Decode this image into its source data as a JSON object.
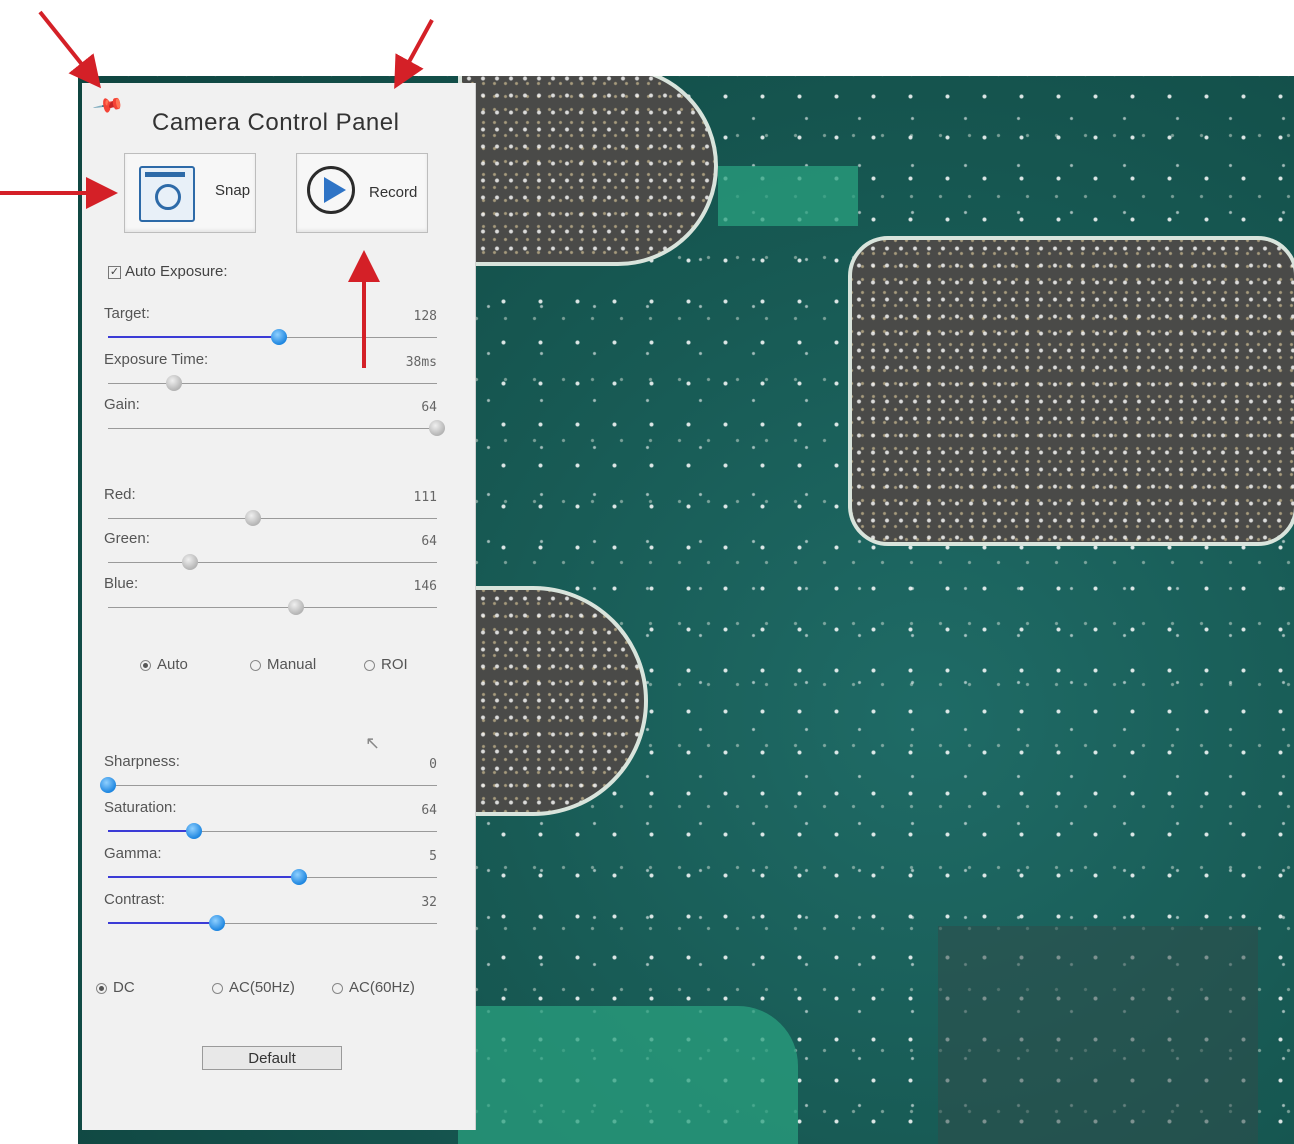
{
  "panel": {
    "title": "Camera Control Panel",
    "snap_label": "Snap",
    "record_label": "Record",
    "auto_exposure_label": "Auto Exposure:",
    "auto_exposure_checked": true,
    "default_label": "Default"
  },
  "sliders_exposure": [
    {
      "label": "Target:",
      "value": "128",
      "level": 0.52,
      "style": "blue",
      "filled": true
    },
    {
      "label": "Exposure Time:",
      "value": "38ms",
      "level": 0.2,
      "style": "grey",
      "filled": false
    },
    {
      "label": "Gain:",
      "value": "64",
      "level": 1.0,
      "style": "grey",
      "filled": false
    }
  ],
  "sliders_color": [
    {
      "label": "Red:",
      "value": "111",
      "level": 0.44,
      "style": "grey",
      "filled": false
    },
    {
      "label": "Green:",
      "value": "64",
      "level": 0.25,
      "style": "grey",
      "filled": false
    },
    {
      "label": "Blue:",
      "value": "146",
      "level": 0.57,
      "style": "grey",
      "filled": false
    }
  ],
  "wb_modes": [
    {
      "label": "Auto",
      "selected": true
    },
    {
      "label": "Manual",
      "selected": false
    },
    {
      "label": "ROI",
      "selected": false
    }
  ],
  "sliders_image": [
    {
      "label": "Sharpness:",
      "value": "0",
      "level": 0.0,
      "style": "blue",
      "filled": false
    },
    {
      "label": "Saturation:",
      "value": "64",
      "level": 0.26,
      "style": "blue",
      "filled": true
    },
    {
      "label": "Gamma:",
      "value": "5",
      "level": 0.58,
      "style": "blue",
      "filled": true
    },
    {
      "label": "Contrast:",
      "value": "32",
      "level": 0.33,
      "style": "blue",
      "filled": true
    }
  ],
  "flicker_modes": [
    {
      "label": "DC",
      "selected": true
    },
    {
      "label": "AC(50Hz)",
      "selected": false
    },
    {
      "label": "AC(60Hz)",
      "selected": false
    }
  ],
  "icons": {
    "pin": "pushpin-icon",
    "snap": "camera-icon",
    "record": "play-circle-icon",
    "cursor": "mouse-cursor-icon"
  },
  "colors": {
    "arrow": "#d42027",
    "slider_blue": "#1e86e0",
    "pcb_green": "#1f6b66"
  }
}
